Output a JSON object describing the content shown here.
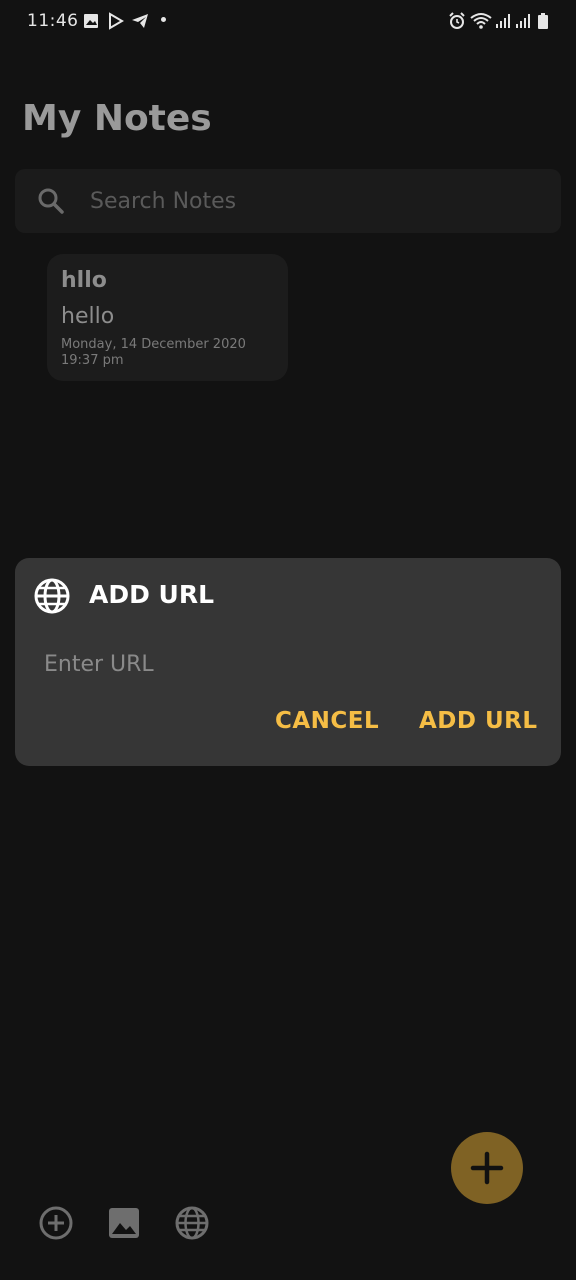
{
  "status_bar": {
    "time": "11:46"
  },
  "header": {
    "title": "My Notes"
  },
  "search": {
    "placeholder": "Search Notes",
    "value": ""
  },
  "notes": [
    {
      "title": "hllo",
      "body": "hello",
      "date": "Monday, 14 December 2020",
      "time": "19:37 pm"
    }
  ],
  "dialog": {
    "title": "ADD URL",
    "input_placeholder": "Enter URL",
    "input_value": "",
    "cancel_label": "CANCEL",
    "confirm_label": "ADD URL",
    "accent_color": "#f5bd45"
  },
  "bottom_bar": {
    "icons": [
      "add-circle-icon",
      "image-icon",
      "globe-icon"
    ],
    "fab_icon": "plus-icon"
  }
}
